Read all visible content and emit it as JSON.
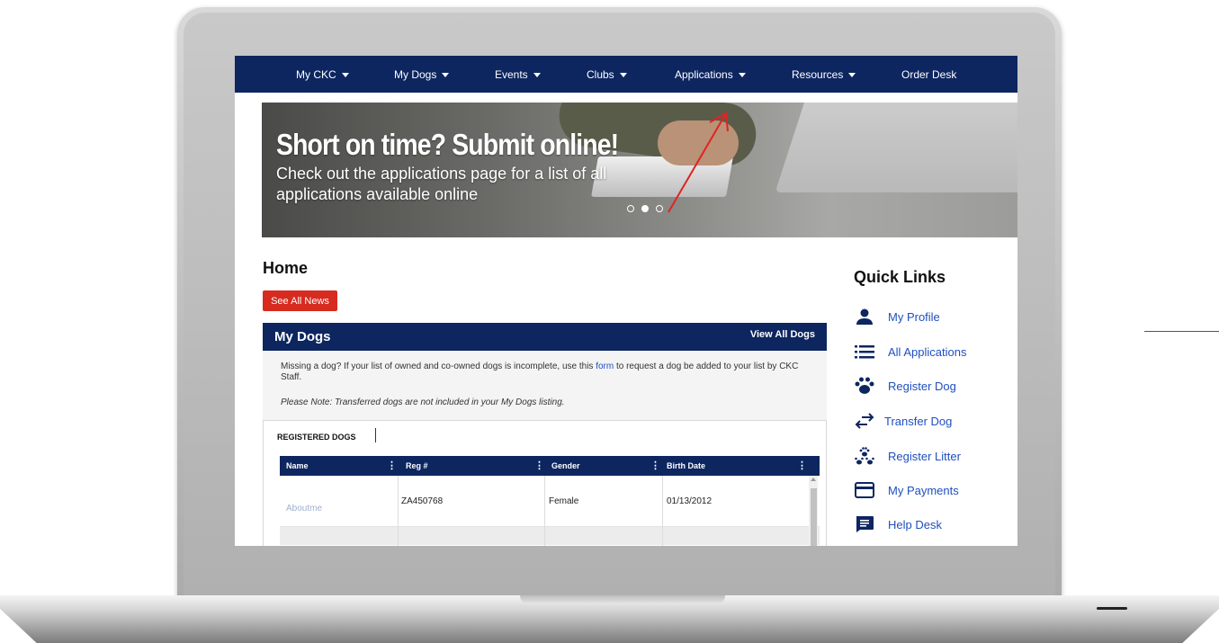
{
  "nav": {
    "items": [
      {
        "label": "My CKC",
        "has_caret": true
      },
      {
        "label": "My Dogs",
        "has_caret": true
      },
      {
        "label": "Events",
        "has_caret": true
      },
      {
        "label": "Clubs",
        "has_caret": true
      },
      {
        "label": "Applications",
        "has_caret": true
      },
      {
        "label": "Resources",
        "has_caret": true
      },
      {
        "label": "Order Desk",
        "has_caret": false
      }
    ]
  },
  "hero": {
    "title": "Short on time? Submit online!",
    "subtitle": "Check out the applications page for a list of all applications available online",
    "slides": 3,
    "active_slide": 2
  },
  "main": {
    "title": "Home",
    "news_button": "See All News",
    "my_dogs": {
      "title": "My Dogs",
      "view_all": "View All Dogs",
      "text_before_link": "Missing a dog? If your list of owned and co-owned dogs is incomplete, use this ",
      "link_text": "form",
      "text_after_link": " to request a dog be added to your list by CKC Staff.",
      "note": "Please Note: Transferred dogs are not included in your My Dogs listing.",
      "tab_label": "REGISTERED DOGS",
      "columns": [
        "Name",
        "Reg #",
        "Gender",
        "Birth Date"
      ],
      "rows": [
        {
          "name": "Aboutme",
          "reg": "ZA450768",
          "gender": "Female",
          "birth_date": "01/13/2012"
        }
      ]
    }
  },
  "quick_links": {
    "title": "Quick Links",
    "items": [
      {
        "label": "My Profile",
        "icon": "person-icon"
      },
      {
        "label": "All Applications",
        "icon": "list-icon"
      },
      {
        "label": "Register Dog",
        "icon": "paw-icon"
      },
      {
        "label": "Transfer Dog",
        "icon": "transfer-arrows-icon"
      },
      {
        "label": "Register Litter",
        "icon": "litter-paws-icon"
      },
      {
        "label": "My Payments",
        "icon": "credit-card-icon"
      },
      {
        "label": "Help Desk",
        "icon": "chat-bubble-icon"
      }
    ]
  },
  "colors": {
    "navy": "#0d2660",
    "accent_red": "#d62b1e",
    "link_blue": "#1f4fbf",
    "annotation_red": "#e02424"
  }
}
